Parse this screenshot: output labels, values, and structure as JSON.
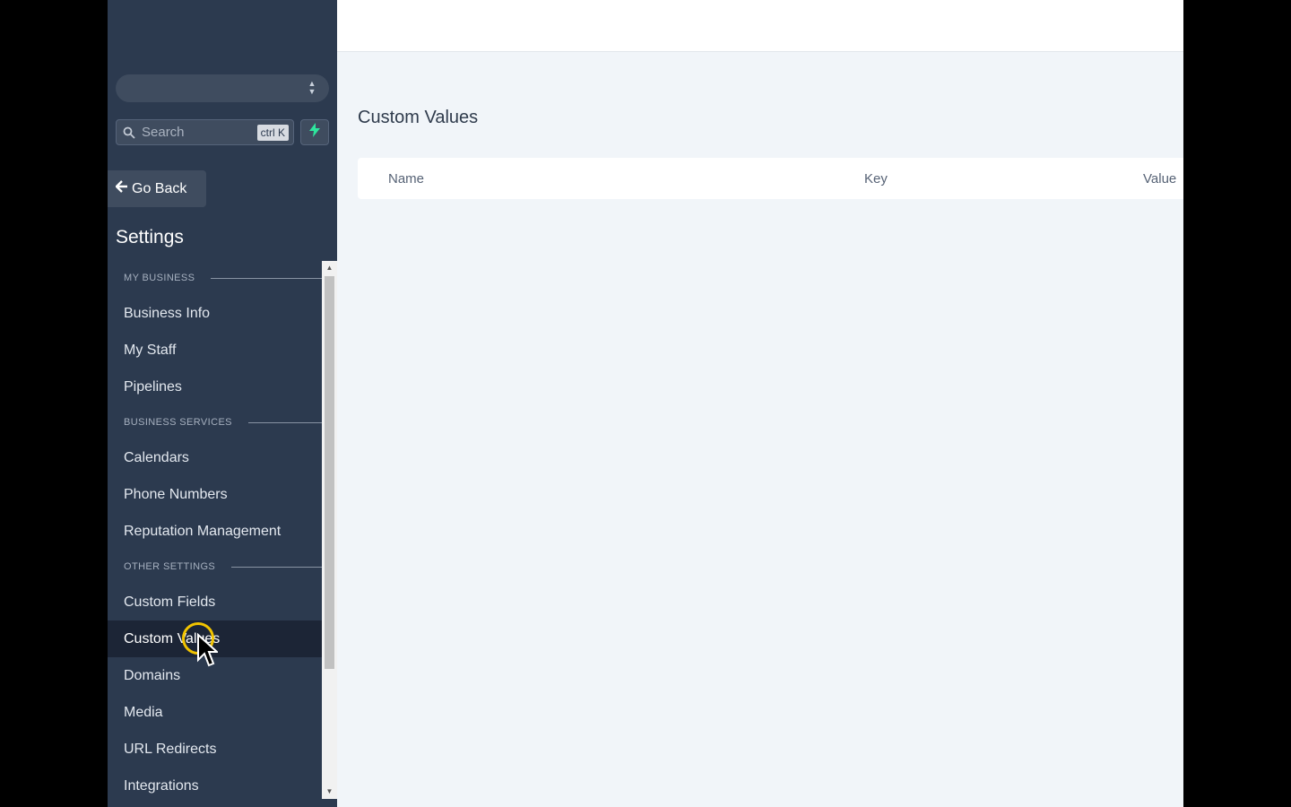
{
  "sidebar": {
    "search": {
      "placeholder": "Search",
      "shortcut": "ctrl K"
    },
    "go_back_label": "Go Back",
    "settings_title": "Settings",
    "sections": [
      {
        "label": "MY BUSINESS",
        "items": [
          "Business Info",
          "My Staff",
          "Pipelines"
        ]
      },
      {
        "label": "BUSINESS SERVICES",
        "items": [
          "Calendars",
          "Phone Numbers",
          "Reputation Management"
        ]
      },
      {
        "label": "OTHER SETTINGS",
        "items": [
          "Custom Fields",
          "Custom Values",
          "Domains",
          "Media",
          "URL Redirects",
          "Integrations"
        ]
      }
    ],
    "active_item": "Custom Values"
  },
  "main": {
    "title": "Custom Values",
    "table": {
      "columns": [
        "Name",
        "Key",
        "Value"
      ]
    }
  },
  "colors": {
    "sidebar_bg": "#2c3a4f",
    "active_item_bg": "#1c2536",
    "quick_action_accent": "#2ee59d",
    "cursor_highlight": "#f2c400"
  }
}
